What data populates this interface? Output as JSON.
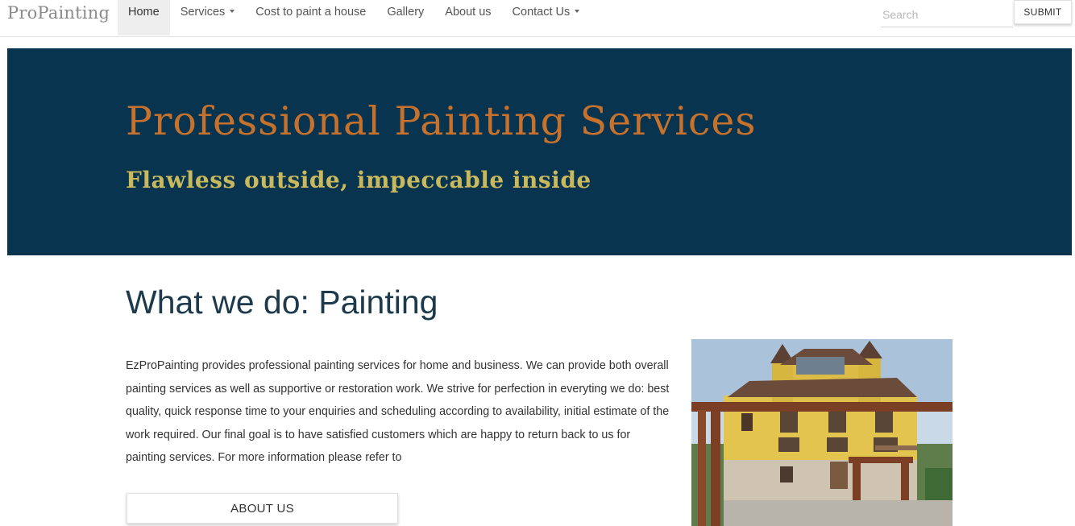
{
  "navbar": {
    "brand": "ProPainting",
    "items": [
      {
        "label": "Home",
        "active": true,
        "dropdown": false
      },
      {
        "label": "Services",
        "active": false,
        "dropdown": true
      },
      {
        "label": "Cost to paint a house",
        "active": false,
        "dropdown": false
      },
      {
        "label": "Gallery",
        "active": false,
        "dropdown": false
      },
      {
        "label": "About us",
        "active": false,
        "dropdown": false
      },
      {
        "label": "Contact Us",
        "active": false,
        "dropdown": true
      }
    ],
    "search_placeholder": "Search",
    "submit_label": "SUBMIT"
  },
  "hero": {
    "title": "Professional Painting Services",
    "subtitle": "Flawless outside, impeccable inside",
    "background_color": "#08344f",
    "title_color": "#c7722c",
    "subtitle_color": "#c9b95c"
  },
  "main": {
    "section_title": "What we do: Painting",
    "paragraph": "EzProPainting provides professional painting services for home and business. We can provide both overall painting services as well as supportive or restoration work. We strive for perfection in everyting we do: best quality, quick response time to your enquiries and scheduling according to availability, initial estimate of the work required. Our final goal is to have satisfied customers which are happy to return back to us for painting services. For more information please refer to",
    "about_button": "ABOUT US",
    "photo_subject": "yellow-house-photo"
  }
}
